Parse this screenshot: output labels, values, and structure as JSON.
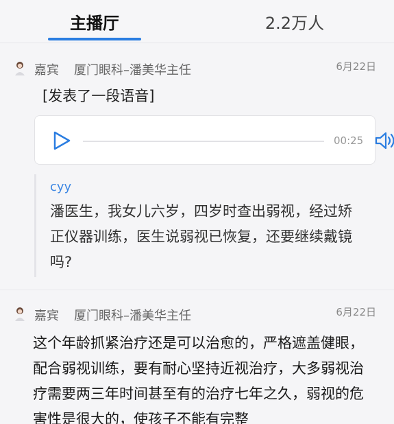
{
  "tabs": {
    "main": "主播厅",
    "count": "2.2万人"
  },
  "posts": [
    {
      "role": "嘉宾",
      "author": "厦门眼科–潘美华主任",
      "date": "6月22日",
      "text": "[发表了一段语音]",
      "audio": {
        "duration": "00:25",
        "play_icon": "play-icon",
        "speaker_icon": "speaker-icon"
      },
      "quote": {
        "user": "cyy",
        "text": "潘医生，我女儿六岁，四岁时查出弱视，经过矫正仪器训练，医生说弱视已恢复，还要继续戴镜吗?"
      }
    },
    {
      "role": "嘉宾",
      "author": "厦门眼科–潘美华主任",
      "date": "6月22日",
      "text": "这个年龄抓紧治疗还是可以治愈的，严格遮盖健眼，配合弱视训练，要有耐心坚持近视治疗，大多弱视治疗需要两三年时间甚至有的治疗七年之久，弱视的危害性是很大的，使孩子不能有完整"
    }
  ],
  "colors": {
    "accent": "#2a7de1",
    "quote_user": "#3b86e3"
  }
}
